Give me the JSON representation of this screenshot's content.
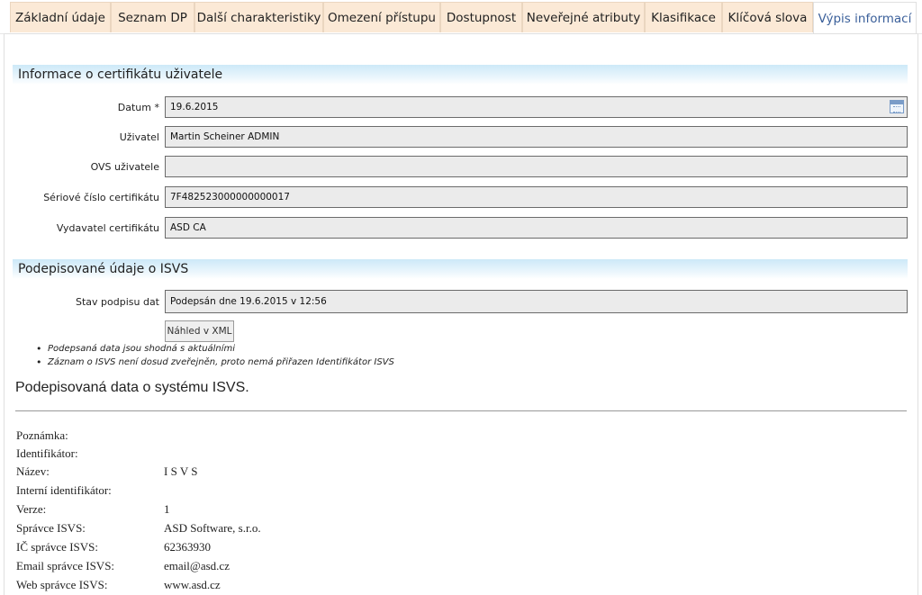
{
  "tabs": [
    {
      "label": "Základní údaje"
    },
    {
      "label": "Seznam DP"
    },
    {
      "label": "Další charakteristiky"
    },
    {
      "label": "Omezení přístupu"
    },
    {
      "label": "Dostupnost"
    },
    {
      "label": "Neveřejné atributy"
    },
    {
      "label": "Klasifikace"
    },
    {
      "label": "Klíčová slova"
    },
    {
      "label": "Výpis informací",
      "active": true
    }
  ],
  "certificate_section": {
    "title": "Informace o certifikátu uživatele",
    "fields": [
      {
        "label": "Datum *",
        "value": "19.6.2015"
      },
      {
        "label": "Uživatel",
        "value": "Martin Scheiner ADMIN"
      },
      {
        "label": "OVS uživatele",
        "value": ""
      },
      {
        "label": "Sériové číslo certifikátu",
        "value": "7F482523000000000017"
      },
      {
        "label": "Vydavatel certifikátu",
        "value": "ASD CA"
      }
    ]
  },
  "signed_section": {
    "title": "Podepisované údaje o ISVS",
    "status_label": "Stav podpisu dat",
    "status_value": "Podepsán dne 19.6.2015 v 12:56",
    "preview_button": "Náhled v XML",
    "notes": [
      "Podepsaná data jsou shodná s aktuálními",
      "Záznam o ISVS není dosud zveřejněn, proto nemá přiřazen Identifikátor ISVS"
    ]
  },
  "signed_data": {
    "heading": "Podepisovaná data o systému ISVS.",
    "rows": [
      {
        "label": "Poznámka:",
        "value": ""
      },
      {
        "label": "Identifikátor:",
        "value": ""
      },
      {
        "label": "Název:",
        "value": "I S V S"
      },
      {
        "label": "Interní identifikátor:",
        "value": ""
      },
      {
        "label": "Verze:",
        "value": "1"
      },
      {
        "label": "Správce ISVS:",
        "value": "ASD Software, s.r.o."
      },
      {
        "label": "IČ správce ISVS:",
        "value": "62363930"
      },
      {
        "label": "Email správce ISVS:",
        "value": "email@asd.cz"
      },
      {
        "label": "Web správce ISVS:",
        "value": "www.asd.cz"
      }
    ]
  },
  "icons": {
    "date_picker": "calendar-icon"
  },
  "colors": {
    "tab_bg": "#fbe9d6",
    "active_tab_text": "#3a5f9a",
    "section_bar": "#cde9f8"
  }
}
